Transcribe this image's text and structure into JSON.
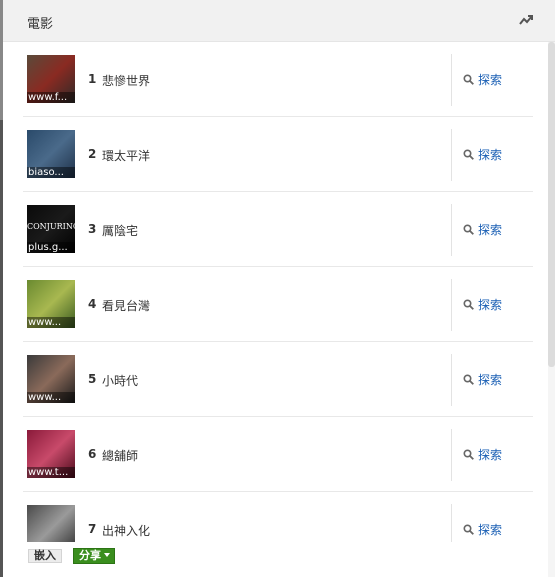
{
  "header": {
    "title": "電影",
    "trend_icon": "trending-icon"
  },
  "list": {
    "explore_icon": "search-icon",
    "items": [
      {
        "rank": "1",
        "title": "悲慘世界",
        "thumb_caption": "www.f...",
        "explore_label": "探索",
        "thumb_colors": [
          "#5a4a3a",
          "#8a2a22",
          "#2e2a28"
        ]
      },
      {
        "rank": "2",
        "title": "環太平洋",
        "thumb_caption": "biaso...",
        "explore_label": "探索",
        "thumb_colors": [
          "#2a4a6a",
          "#4a6a8a",
          "#1e3048"
        ]
      },
      {
        "rank": "3",
        "title": "厲陰宅",
        "thumb_caption": "plus.g...",
        "explore_label": "探索",
        "thumb_text": "CONJURING",
        "thumb_colors": [
          "#0a0a0a",
          "#1a1a1a",
          "#000000"
        ]
      },
      {
        "rank": "4",
        "title": "看見台灣",
        "thumb_caption": "www...",
        "explore_label": "探索",
        "thumb_colors": [
          "#6a8a30",
          "#a8b850",
          "#3a5a20"
        ]
      },
      {
        "rank": "5",
        "title": "小時代",
        "thumb_caption": "www...",
        "explore_label": "探索",
        "thumb_colors": [
          "#3a3a3a",
          "#8a6a5a",
          "#1a1a1a"
        ]
      },
      {
        "rank": "6",
        "title": "總舖師",
        "thumb_caption": "www.t...",
        "explore_label": "探索",
        "thumb_colors": [
          "#8a1a3a",
          "#c84a6a",
          "#4a0a1a"
        ]
      },
      {
        "rank": "7",
        "title": "出神入化",
        "thumb_caption": "",
        "explore_label": "探索",
        "thumb_colors": [
          "#4a4a4a",
          "#9a9a9a",
          "#2a2a2a"
        ]
      }
    ]
  },
  "footer": {
    "embed_label": "嵌入",
    "share_label": "分享"
  },
  "colors": {
    "link": "#1a5fb4",
    "share_green": "#3a8e1e",
    "header_bg": "#f1f1f1"
  }
}
